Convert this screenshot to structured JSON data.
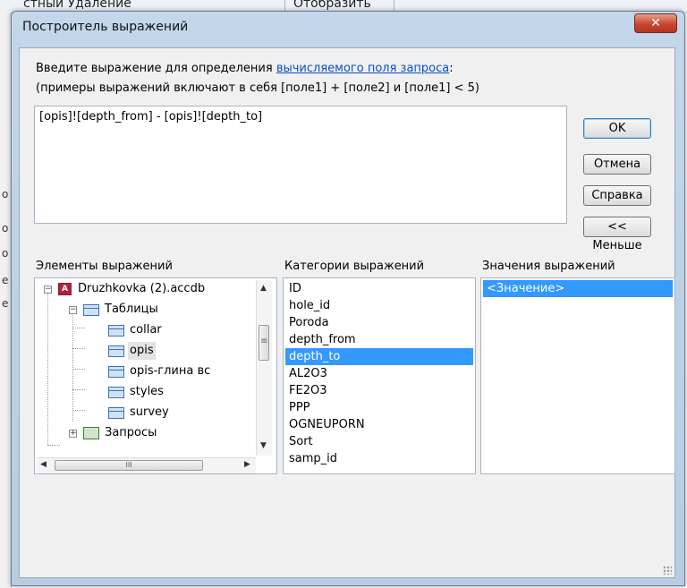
{
  "background": {
    "menu_text_1": "стный Удаление",
    "menu_text_2": "Отобразить",
    "edge_letters": [
      "о",
      "о",
      "о",
      "е",
      "е"
    ]
  },
  "window": {
    "title": "Построитель выражений",
    "close_glyph": "✕"
  },
  "instructions": {
    "line1_prefix": "Введите выражение для определения ",
    "line1_link": "вычисляемого поля запроса",
    "line1_suffix": ":",
    "line2": "(примеры выражений включают в себя [поле1] + [поле2] и [поле1] < 5)"
  },
  "expression": {
    "value": "[opis]![depth_from] - [opis]![depth_to]"
  },
  "buttons": {
    "ok": "OK",
    "cancel": "Отмена",
    "help": "Справка",
    "less": "<< Меньше"
  },
  "columns": {
    "elements": "Элементы выражений",
    "categories": "Категории выражений",
    "values": "Значения выражений"
  },
  "tree": {
    "database": "Druzhkovka (2).accdb",
    "tables_label": "Таблицы",
    "tables": [
      "collar",
      "opis",
      "opis-глина вс",
      "styles",
      "survey"
    ],
    "selected_table": "opis",
    "queries_label": "Запросы",
    "expanded_glyph": "−",
    "collapsed_glyph": "+",
    "db_icon_letter": "A"
  },
  "categories": {
    "items": [
      "ID",
      "hole_id",
      "Poroda",
      "depth_from",
      "depth_to",
      "AL2O3",
      "FE2O3",
      "PPP",
      "OGNEUPORN",
      "Sort",
      "samp_id"
    ],
    "selected": "depth_to"
  },
  "values": {
    "items": [
      "<Значение>"
    ],
    "selected": "<Значение>"
  },
  "scroll": {
    "up": "▲",
    "down": "▼",
    "left": "◀",
    "right": "▶",
    "grip_v": "≡",
    "grip_h": "III"
  }
}
